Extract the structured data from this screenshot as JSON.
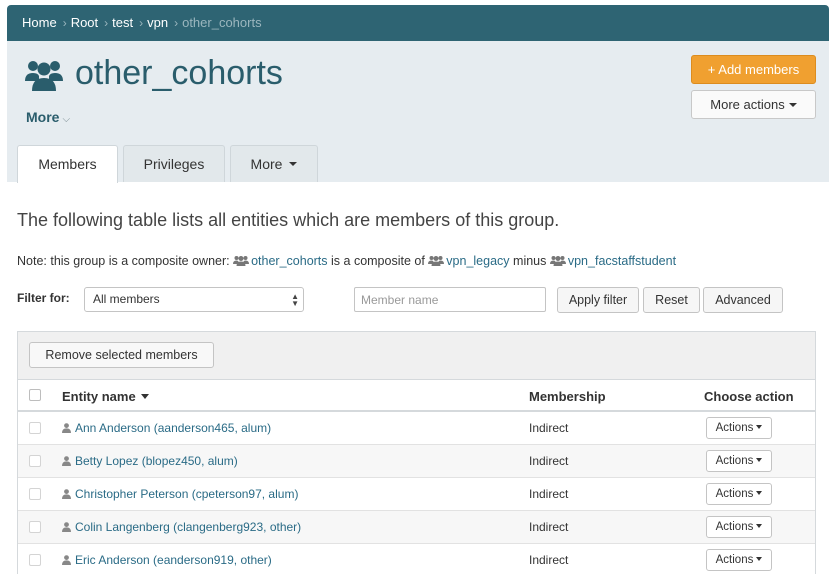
{
  "breadcrumb": {
    "items": [
      "Home",
      "Root",
      "test",
      "vpn"
    ],
    "current": "other_cohorts"
  },
  "header": {
    "title": "other_cohorts",
    "title_icon": "group-icon",
    "more_label": "More",
    "add_members_label": "+ Add members",
    "more_actions_label": "More actions"
  },
  "tabs": [
    {
      "label": "Members",
      "active": true
    },
    {
      "label": "Privileges",
      "active": false
    },
    {
      "label": "More",
      "active": false
    }
  ],
  "content": {
    "intro": "The following table lists all entities which are members of this group.",
    "note": {
      "prefix": "Note: this group is a composite owner:",
      "group": "other_cohorts",
      "mid": "is a composite of",
      "left_factor": "vpn_legacy",
      "op": "minus",
      "right_factor": "vpn_facstaffstudent"
    }
  },
  "filter": {
    "label": "Filter for:",
    "selected": "All members",
    "name_placeholder": "Member name",
    "apply_label": "Apply filter",
    "reset_label": "Reset",
    "advanced_label": "Advanced"
  },
  "table": {
    "remove_label": "Remove selected members",
    "columns": {
      "entity": "Entity name",
      "membership": "Membership",
      "action": "Choose action"
    },
    "rows": [
      {
        "name": "Ann Anderson (aanderson465, alum)",
        "membership": "Indirect",
        "action": "Actions"
      },
      {
        "name": "Betty Lopez (blopez450, alum)",
        "membership": "Indirect",
        "action": "Actions"
      },
      {
        "name": "Christopher Peterson (cpeterson97, alum)",
        "membership": "Indirect",
        "action": "Actions"
      },
      {
        "name": "Colin Langenberg (clangenberg923, other)",
        "membership": "Indirect",
        "action": "Actions"
      },
      {
        "name": "Eric Anderson (eanderson919, other)",
        "membership": "Indirect",
        "action": "Actions"
      }
    ]
  },
  "colors": {
    "topbar": "#2e6473",
    "header_bg": "#e6ecf0",
    "title": "#2a5d6c",
    "add_button": "#f0a030",
    "link": "#2a6b86"
  }
}
